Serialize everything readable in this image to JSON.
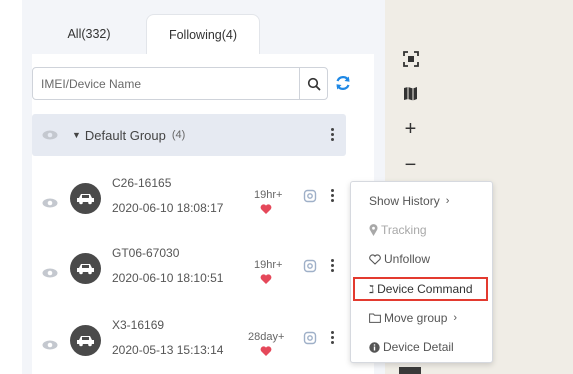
{
  "tabs": {
    "all_label": "All(332)",
    "following_label": "Following(4)"
  },
  "search": {
    "placeholder": "IMEI/Device Name"
  },
  "group": {
    "name": "Default Group",
    "count": "(4)"
  },
  "devices": [
    {
      "name": "C26-16165",
      "time": "2020-06-10 18:08:17",
      "duration": "19hr+"
    },
    {
      "name": "GT06-67030",
      "time": "2020-06-10 18:10:51",
      "duration": "19hr+"
    },
    {
      "name": "X3-16169",
      "time": "2020-05-13 15:13:14",
      "duration": "28day+"
    }
  ],
  "map_controls": {
    "zoom_in": "+",
    "zoom_out": "−"
  },
  "menu": {
    "show_history": "Show History",
    "show_history_arrow": "›",
    "tracking": "Tracking",
    "unfollow": "Unfollow",
    "device_command_icon": "ℷ",
    "device_command": "Device Command",
    "move_group": "Move group",
    "move_group_arrow": "›",
    "device_detail": "Device Detail"
  },
  "colors": {
    "accent_blue": "#2f66d8",
    "heart_red": "#e5485a",
    "highlight_red": "#e33a2f",
    "refresh_blue": "#1e88e5"
  },
  "icons": [
    "search-icon",
    "refresh-icon",
    "eye-icon",
    "car-icon",
    "heart-icon",
    "target-icon",
    "locate-icon",
    "layers-icon",
    "map-pin-icon",
    "heart-outline-icon",
    "folder-icon",
    "info-icon"
  ]
}
